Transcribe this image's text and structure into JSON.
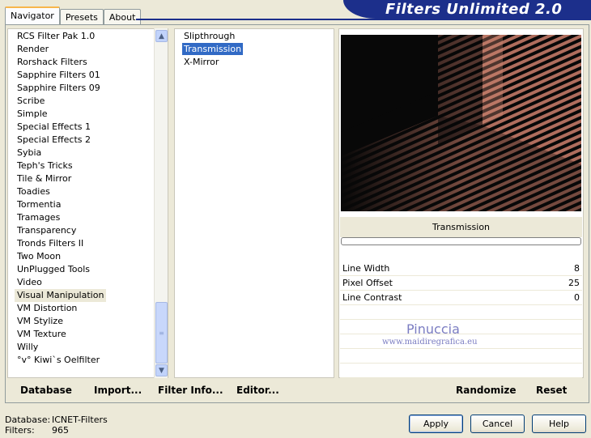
{
  "tabs": [
    "Navigator",
    "Presets",
    "About"
  ],
  "title": "Filters Unlimited 2.0",
  "categories": [
    "RCS Filter Pak 1.0",
    "Render",
    "Rorshack Filters",
    "Sapphire Filters 01",
    "Sapphire Filters 09",
    "Scribe",
    "Simple",
    "Special Effects 1",
    "Special Effects 2",
    "Sybia",
    "Teph's Tricks",
    "Tile & Mirror",
    "Toadies",
    "Tormentia",
    "Tramages",
    "Transparency",
    "Tronds Filters II",
    "Two Moon",
    "UnPlugged Tools",
    "Video",
    "Visual Manipulation",
    "VM Distortion",
    "VM Stylize",
    "VM Texture",
    "Willy",
    "°v° Kiwi`s Oelfilter"
  ],
  "selected_category_index": 20,
  "filters": [
    "Slipthrough",
    "Transmission",
    "X-Mirror"
  ],
  "selected_filter_index": 1,
  "current_filter_name": "Transmission",
  "parameters": [
    {
      "label": "Line Width",
      "value": "8"
    },
    {
      "label": "Pixel Offset",
      "value": "25"
    },
    {
      "label": "Line Contrast",
      "value": "0"
    }
  ],
  "watermark": {
    "name": "Pinuccia",
    "site": "www.maidiregrafica.eu"
  },
  "left_buttons": {
    "database": "Database",
    "import": "Import...",
    "filter_info": "Filter Info...",
    "editor": "Editor..."
  },
  "right_buttons": {
    "randomize": "Randomize",
    "reset": "Reset"
  },
  "footer": {
    "database_label": "Database:",
    "database_value": "ICNET-Filters",
    "filters_label": "Filters:",
    "filters_value": "965"
  },
  "dialog_buttons": {
    "apply": "Apply",
    "cancel": "Cancel",
    "help": "Help"
  },
  "colors": {
    "banner": "#1c2f8b",
    "selection": "#316ac5",
    "preview_stripe": "#c27866"
  }
}
